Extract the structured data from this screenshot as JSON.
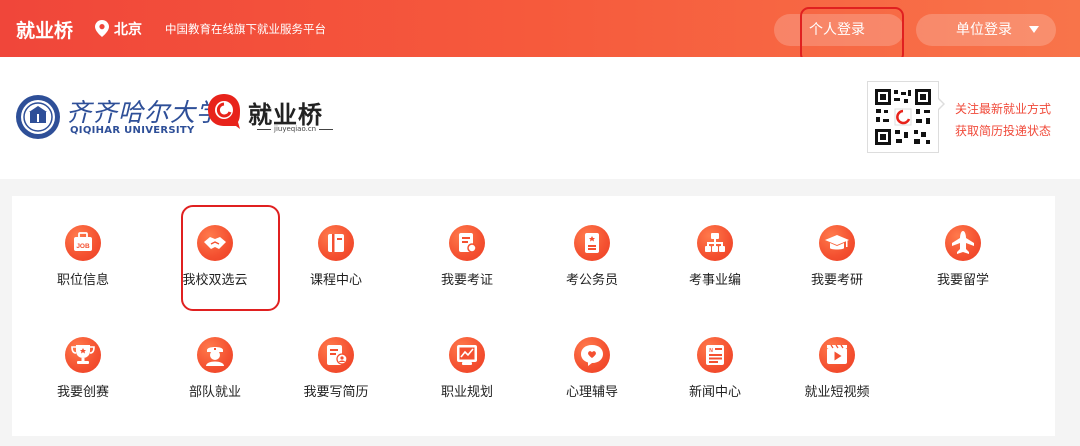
{
  "topbar": {
    "brand": "就业桥",
    "location": "北京",
    "slogan": "中国教育在线旗下就业服务平台",
    "personal_login": "个人登录",
    "unit_login": "单位登录",
    "accent": "#f0463a"
  },
  "header": {
    "university_cn": "齐齐哈尔大学",
    "university_en": "QIQIHAR UNIVERSITY",
    "logo_text": "就业桥",
    "logo_domain": "jiuyeqiao.cn",
    "qr_line1": "关注最新就业方式",
    "qr_line2": "获取简历投递状态"
  },
  "services": [
    {
      "label": "职位信息",
      "icon": "job-icon"
    },
    {
      "label": "我校双选云",
      "icon": "handshake-icon"
    },
    {
      "label": "课程中心",
      "icon": "book-icon"
    },
    {
      "label": "我要考证",
      "icon": "certificate-icon"
    },
    {
      "label": "考公务员",
      "icon": "civil-service-icon"
    },
    {
      "label": "考事业编",
      "icon": "org-chart-icon"
    },
    {
      "label": "我要考研",
      "icon": "graduation-cap-icon"
    },
    {
      "label": "我要留学",
      "icon": "plane-icon"
    },
    {
      "label": "我要创赛",
      "icon": "trophy-icon"
    },
    {
      "label": "部队就业",
      "icon": "soldier-icon"
    },
    {
      "label": "我要写简历",
      "icon": "resume-icon"
    },
    {
      "label": "职业规划",
      "icon": "chart-board-icon"
    },
    {
      "label": "心理辅导",
      "icon": "heart-chat-icon"
    },
    {
      "label": "新闻中心",
      "icon": "news-icon"
    },
    {
      "label": "就业短视频",
      "icon": "video-icon"
    }
  ]
}
